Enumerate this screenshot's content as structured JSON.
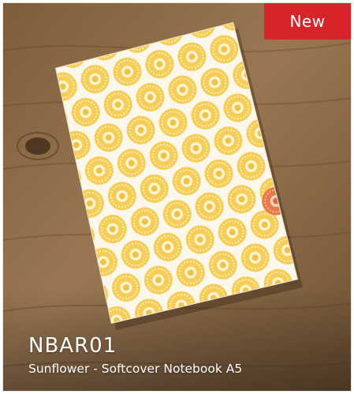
{
  "product": {
    "badge": "New",
    "code": "NBAR01",
    "title": "Sunflower - Softcover Notebook A5"
  },
  "photo": {
    "subject": "notebook-on-wooden-table",
    "pattern": "sunflower",
    "colors": {
      "wood": "#8c6a44",
      "cover_background": "#fbf7ea",
      "sunflower_petal": "#f3c545",
      "sunflower_accent": "#e2784d",
      "badge": "#d7242b"
    }
  }
}
